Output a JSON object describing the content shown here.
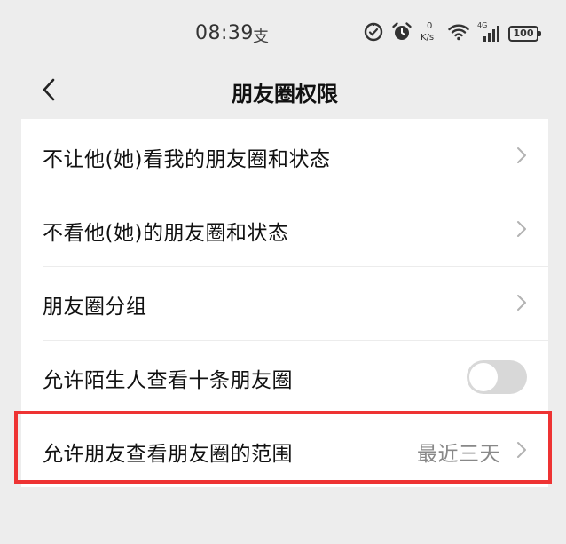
{
  "status_bar": {
    "time": "08:39",
    "app_glyph": "支",
    "net_speed_value": "0",
    "net_speed_unit": "K/s",
    "network_type": "4G",
    "battery": "100"
  },
  "nav": {
    "title": "朋友圈权限"
  },
  "settings": {
    "items": [
      {
        "label": "不让他(她)看我的朋友圈和状态"
      },
      {
        "label": "不看他(她)的朋友圈和状态"
      },
      {
        "label": "朋友圈分组"
      },
      {
        "label": "允许陌生人查看十条朋友圈",
        "toggle_on": false
      },
      {
        "label": "允许朋友查看朋友圈的范围",
        "value": "最近三天"
      }
    ]
  },
  "colors": {
    "background": "#ededed",
    "row_background": "#ffffff",
    "highlight": "#ee3333",
    "toggle_off": "#d8d8d8"
  },
  "icons": [
    "data-saver-icon",
    "alarm-icon",
    "wifi-icon",
    "signal-icon",
    "battery-icon",
    "back-chevron-icon",
    "chevron-right-icon"
  ]
}
